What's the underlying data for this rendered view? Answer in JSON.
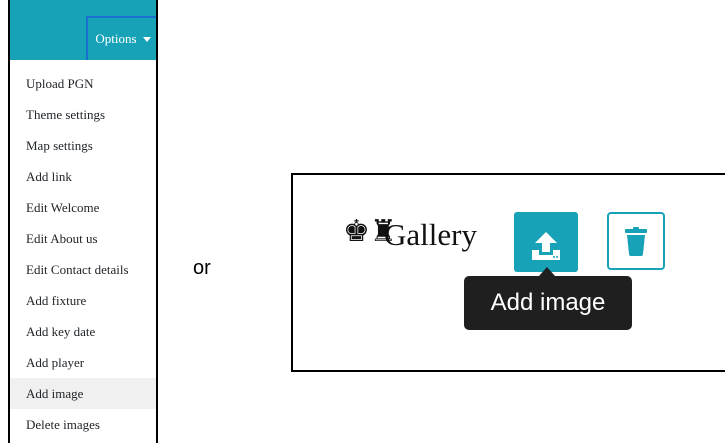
{
  "options_menu": {
    "button_label": "Options",
    "items": [
      {
        "label": "Upload PGN"
      },
      {
        "label": "Theme settings"
      },
      {
        "label": "Map settings"
      },
      {
        "label": "Add link"
      },
      {
        "label": "Edit Welcome"
      },
      {
        "label": "Edit About us"
      },
      {
        "label": "Edit Contact details"
      },
      {
        "label": "Add fixture"
      },
      {
        "label": "Add key date"
      },
      {
        "label": "Add player"
      },
      {
        "label": "Add image",
        "highlighted": true
      },
      {
        "label": "Delete images"
      }
    ]
  },
  "separator_text": "or",
  "gallery": {
    "title": "Gallery",
    "upload_button_icon": "upload-icon",
    "delete_button_icon": "trash-icon",
    "tooltip": "Add image"
  },
  "colors": {
    "accent": "#17a2b8",
    "tooltip_bg": "#1f1f1f",
    "focus_border": "#1b6fd1",
    "highlight_bg": "#f0f0f0"
  }
}
